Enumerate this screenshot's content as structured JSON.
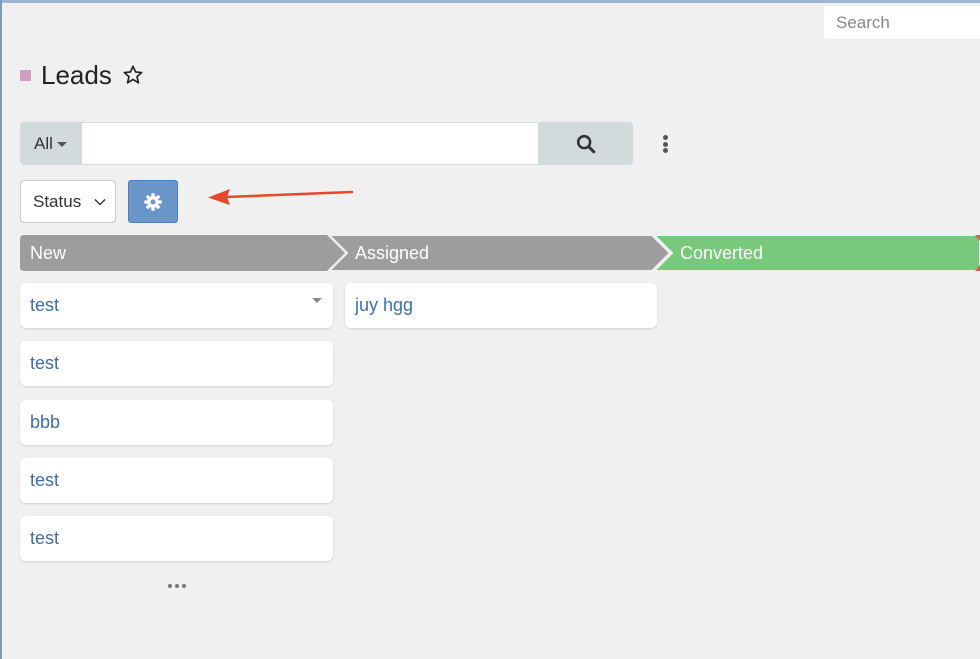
{
  "header": {
    "search_placeholder": "Search",
    "title": "Leads",
    "title_color": "#d19ec1"
  },
  "toolbar": {
    "filter_label": "All",
    "search_value": "",
    "search_icon": "search-icon",
    "more_icon": "vertical-ellipsis-icon"
  },
  "kanban": {
    "group_by": "Status",
    "settings_icon": "gear-icon",
    "stages": [
      {
        "label": "New",
        "color": "#9d9d9d"
      },
      {
        "label": "Assigned",
        "color": "#9d9d9d"
      },
      {
        "label": "Converted",
        "color": "#78c97b"
      }
    ],
    "columns": [
      {
        "stage": "New",
        "cards": [
          "test",
          "test",
          "bbb",
          "test",
          "test"
        ]
      },
      {
        "stage": "Assigned",
        "cards": [
          "juy hgg"
        ]
      },
      {
        "stage": "Converted",
        "cards": []
      }
    ]
  },
  "annotation": {
    "arrow_color": "#e8472a"
  }
}
